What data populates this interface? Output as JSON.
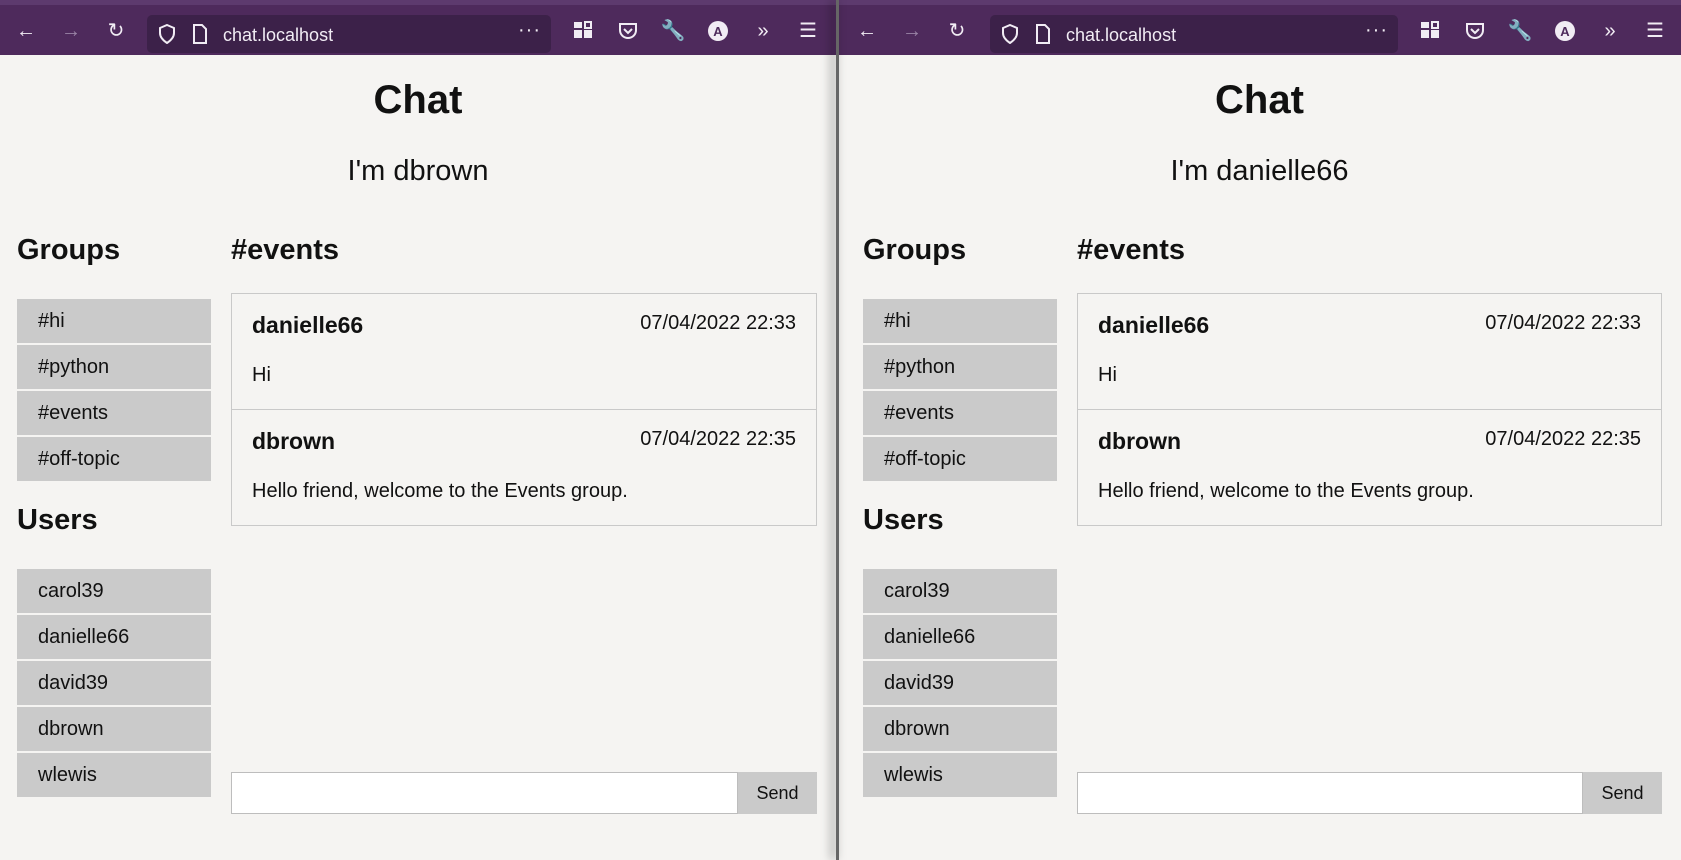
{
  "browser": {
    "url": "chat.localhost",
    "url_menu": "···",
    "avatar_letter": "A",
    "icons": [
      "back-arrow-icon",
      "forward-arrow-icon",
      "reload-icon",
      "shield-icon",
      "page-icon",
      "more-dots-icon",
      "extensions-grid-icon",
      "pocket-icon",
      "wrench-icon",
      "account-avatar-icon",
      "overflow-chevrons-icon",
      "hamburger-menu-icon"
    ]
  },
  "chat": {
    "title": "Chat",
    "groups_heading": "Groups",
    "users_heading": "Users",
    "channel": "#events",
    "groups": [
      "#hi",
      "#python",
      "#events",
      "#off-topic"
    ],
    "users": [
      "carol39",
      "danielle66",
      "david39",
      "dbrown",
      "wlewis"
    ],
    "messages": [
      {
        "author": "danielle66",
        "time": "07/04/2022 22:33",
        "text": "Hi"
      },
      {
        "author": "dbrown",
        "time": "07/04/2022 22:35",
        "text": "Hello friend, welcome to the Events group."
      }
    ],
    "send_label": "Send"
  },
  "windows": {
    "left": {
      "me": "I'm dbrown"
    },
    "right": {
      "me": "I'm danielle66"
    }
  },
  "colors": {
    "toolbar": "#4e2a5c",
    "urlbar": "#3c2149",
    "page_bg": "#f5f4f2",
    "list_item_bg": "#cacaca"
  }
}
